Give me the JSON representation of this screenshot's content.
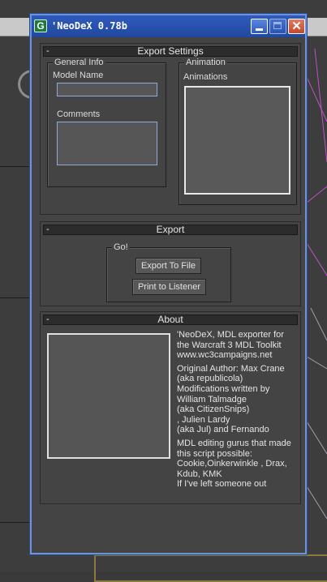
{
  "window": {
    "title": "'NeoDeX 0.78b",
    "icon_glyph": "G",
    "controls": {
      "minimize": "minimize-icon",
      "maximize": "maximize-icon",
      "close_glyph": "✕"
    }
  },
  "export_settings": {
    "title": "Export Settings",
    "toggle": "-",
    "general_info": {
      "legend": "General Info",
      "model_name_label": "Model Name",
      "model_name_value": "",
      "comments_label": "Comments",
      "comments_value": ""
    },
    "animation": {
      "legend": "Animation",
      "animations_label": "Animations",
      "items": []
    }
  },
  "export": {
    "title": "Export",
    "toggle": "-",
    "group_legend": "Go!",
    "export_to_file": "Export To File",
    "print_to_listener": "Print to Listener"
  },
  "about": {
    "title": "About",
    "toggle": "-",
    "paragraphs": [
      "'NeoDeX, MDL exporter for the Warcraft 3 MDL Toolkit\nwww.wc3campaigns.net",
      "Original Author: Max Crane\n(aka republicola)\nModifications written by William Talmadge\n(aka CitizenSnips)\n, Julien Lardy\n(aka Jul) and Fernando",
      "MDL editing gurus that made this script possible:\nCookie,Oinkerwinkle , Drax, Kdub, KMK\nIf I've left someone out"
    ]
  },
  "colors": {
    "titlebar": "#2a52b0",
    "window_bg": "#444444",
    "rollout_header": "#2c2c2c",
    "field_border": "#8daad8",
    "close_button": "#c7472b"
  }
}
